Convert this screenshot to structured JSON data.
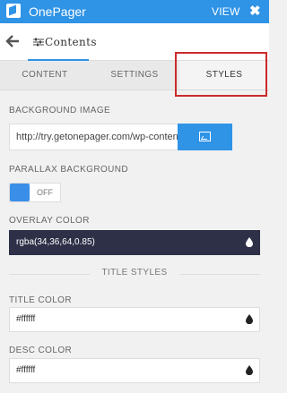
{
  "topbar": {
    "app_title": "OnePager",
    "view_label": "VIEW",
    "close_label": "✖"
  },
  "nav": {
    "crumb_label": "Contents"
  },
  "tabs": [
    {
      "label": "CONTENT"
    },
    {
      "label": "SETTINGS"
    },
    {
      "label": "STYLES",
      "active": true
    }
  ],
  "fields": {
    "background_image": {
      "label": "BACKGROUND IMAGE",
      "value": "http://try.getonepager.com/wp-conten"
    },
    "parallax": {
      "label": "PARALLAX BACKGROUND",
      "state": "OFF"
    },
    "overlay_color": {
      "label": "OVERLAY COLOR",
      "value": "rgba(34,36,64,0.85)"
    },
    "section_title": "TITLE STYLES",
    "title_color": {
      "label": "TITLE COLOR",
      "value": "#ffffff"
    },
    "desc_color": {
      "label": "DESC COLOR",
      "value": "#ffffff"
    }
  },
  "colors": {
    "accent": "#2f93e6",
    "highlight": "#cc2a2a",
    "overlay_swatch": "#2e3048"
  }
}
